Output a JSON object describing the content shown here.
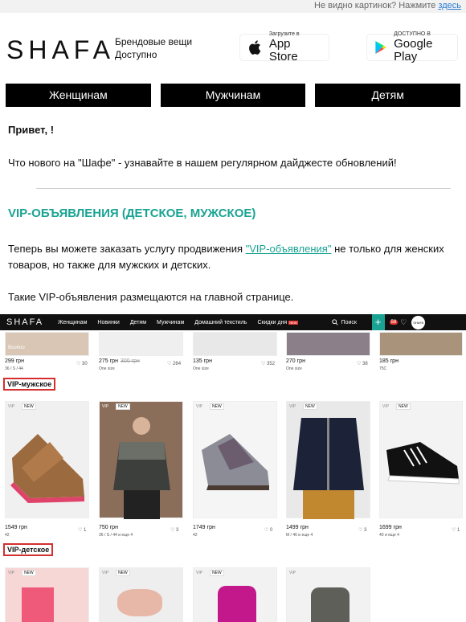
{
  "top_note": {
    "text": "Не видно картинок? Нажмите ",
    "link": "здесь"
  },
  "header": {
    "logo": "SHAFA",
    "tagline_line1": "Брендовые вещи",
    "tagline_line2": "Доступно",
    "appstore_small": "Загрузите в",
    "appstore_big": "App Store",
    "googleplay_small": "ДОСТУПНО В",
    "googleplay_big": "Google Play"
  },
  "categories": [
    "Женщинам",
    "Мужчинам",
    "Детям"
  ],
  "greeting": "Привет, !",
  "intro": "Что нового на \"Шафе\" - узнавайте в нашем регулярном дайджесте обновлений!",
  "section_title": "VIP-ОБЪЯВЛЕНИЯ (ДЕТСКОЕ, МУЖСКОЕ)",
  "body": {
    "part1": "Теперь вы можете заказать услугу продвижения ",
    "link": "\"VIP-объявления\"",
    "part2": " не только для женских товаров, но также для мужских и детских.",
    "placement": "Такие VIP-объявления размещаются на главной странице."
  },
  "site": {
    "logo": "SHAFA",
    "menu": [
      "Женщинам",
      "Новинки",
      "Детям",
      "Мужчинам",
      "Домашний текстиль",
      "Скидки дня"
    ],
    "menu_badge": "NEW",
    "search_label": "Поиск",
    "plus": "+",
    "badge": "58",
    "avatar_text": "SHAFA",
    "top_row": [
      {
        "brand": "Boohoo",
        "price": "299 грн",
        "size": "36 / S / 44",
        "likes": "30",
        "old": ""
      },
      {
        "brand": "",
        "price": "275 грн",
        "size": "One size",
        "likes": "264",
        "old": "300 грн"
      },
      {
        "brand": "",
        "price": "135 грн",
        "size": "One size",
        "likes": "352",
        "old": ""
      },
      {
        "brand": "",
        "price": "270 грн",
        "size": "One size",
        "likes": "38",
        "old": ""
      },
      {
        "brand": "",
        "price": "185 грн",
        "size": "75C",
        "likes": "",
        "old": ""
      }
    ],
    "vip_men": "VIP-мужское",
    "men_row": [
      {
        "price": "1549 грн",
        "size": "42",
        "likes": "1"
      },
      {
        "price": "750 грн",
        "size": "36 / S / 44",
        "extra": "и еще 4",
        "likes": "3"
      },
      {
        "price": "1749 грн",
        "size": "42",
        "likes": "0"
      },
      {
        "price": "1499 грн",
        "size": "M / 46",
        "extra": "и еще 4",
        "likes": "3"
      },
      {
        "price": "1699 грн",
        "size": "40",
        "extra": "и еще 4",
        "likes": "1"
      }
    ],
    "vip_kids": "VIP-детское",
    "tag_vip": "VIP",
    "tag_new": "NEW"
  }
}
